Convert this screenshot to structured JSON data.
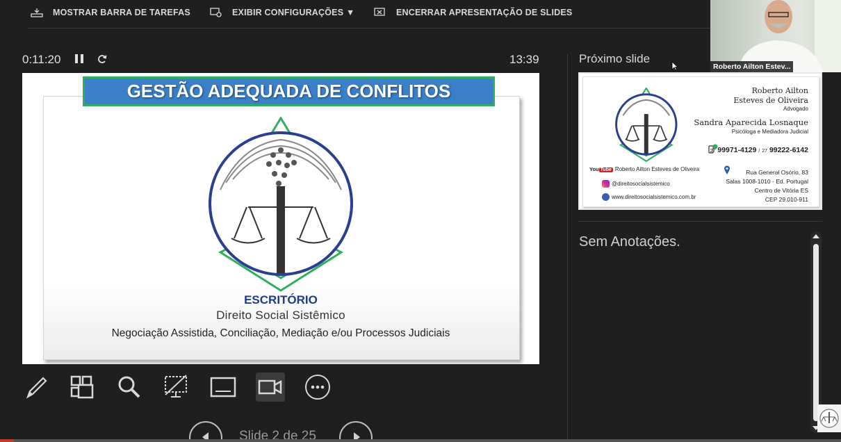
{
  "toolbar": {
    "show_taskbar": "MOSTRAR BARRA DE TAREFAS",
    "display_settings": "EXIBIR CONFIGURAÇÕES ▼",
    "end_slideshow": "ENCERRAR APRESENTAÇÃO DE SLIDES"
  },
  "timer": {
    "elapsed": "0:11:20",
    "clock": "13:39"
  },
  "slide": {
    "title": "GESTÃO ADEQUADA DE CONFLITOS",
    "office": "ESCRITÓRIO",
    "name": "Direito Social Sistêmico",
    "services": "Negociação Assistida, Conciliação, Mediação e/ou Processos Judiciais"
  },
  "navigation": {
    "slide_counter": "Slide 2 de 25"
  },
  "tools": [
    "pen-icon",
    "see-all-slides-icon",
    "zoom-icon",
    "black-screen-icon",
    "subtitles-icon",
    "camera-icon",
    "more-options-icon"
  ],
  "next_slide": {
    "label": "Próximo slide",
    "name_line1": "Roberto Ailton",
    "name_line2": "Esteves de Oliveira",
    "role1": "Advogado",
    "name2": "Sandra Aparecida Losnaque",
    "role2": "Psicóloga e Mediadora Judicial",
    "phone_ddd1": "27",
    "phone1": "99971-4129",
    "phone_sep": "/",
    "phone_ddd2": "27",
    "phone2": "99222-6142",
    "youtube_badge": "Tube",
    "youtube_prefix": "You",
    "youtube": "Roberto Ailton Esteves de Oliveira",
    "instagram": "@direitosocialsistemico",
    "website": "www.direitosocialsistemico.com.br",
    "address_line1": "Rua General Osório, 83",
    "address_line2": "Salas 1008-1010 - Ed. Portugal",
    "address_line3": "Centro de Vitória ES",
    "address_line4": "CEP 29.010-911"
  },
  "notes": {
    "text": "Sem Anotações."
  },
  "webcam": {
    "participant": "Roberto Ailton Estev..."
  },
  "colors": {
    "background": "#1f1f1f",
    "title_bar": "#3a7fc7",
    "title_border": "#2fae60",
    "logo_ring": "#2a3f8f",
    "office_text": "#1e3b8a"
  }
}
